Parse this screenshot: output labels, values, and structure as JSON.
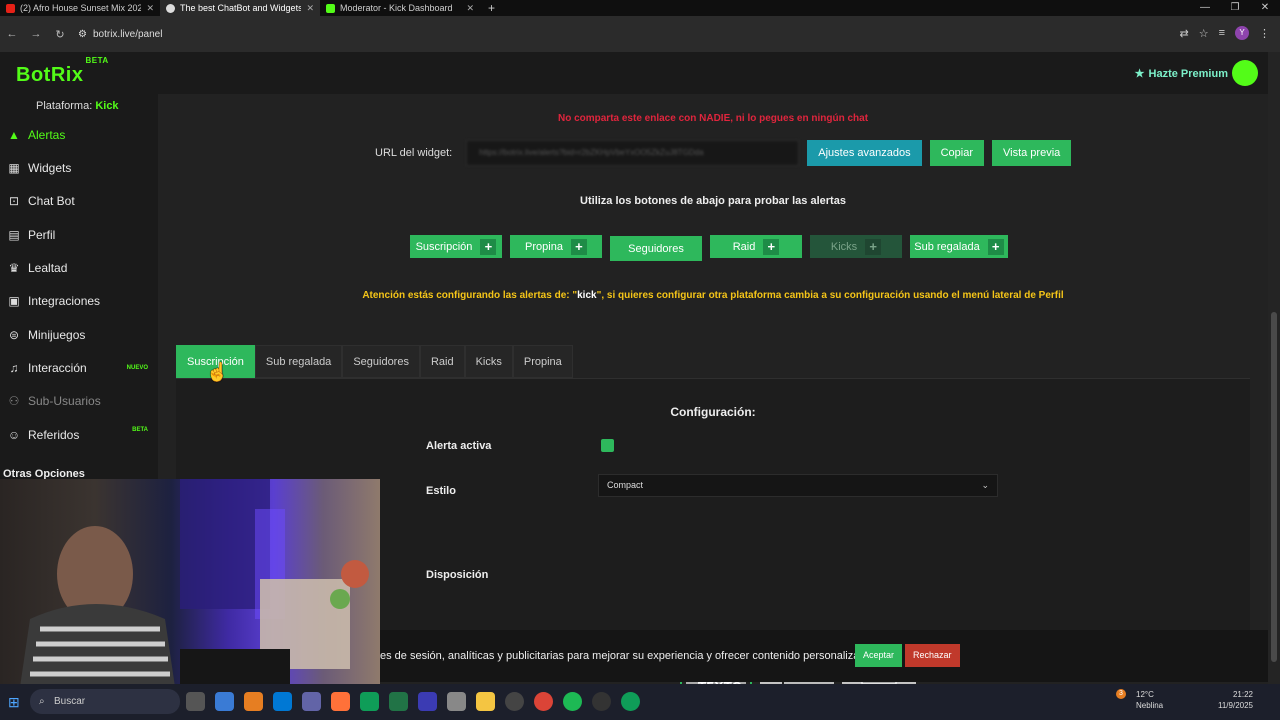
{
  "browser": {
    "tabs": [
      {
        "title": "(2) Afro House Sunset Mix 2025",
        "color": "#e62117",
        "active": false
      },
      {
        "title": "The best ChatBot and Widgets",
        "color": "#dddddd",
        "active": true
      },
      {
        "title": "Moderator - Kick Dashboard",
        "color": "#53fc18",
        "active": false
      }
    ],
    "url": "botrix.live/panel"
  },
  "app": {
    "logo": "BotRix",
    "logo_badge": "BETA",
    "premium": "Hazte Premium",
    "platform_label": "Plataforma:",
    "platform_value": "Kick"
  },
  "sidebar": {
    "items": [
      {
        "label": "Alertas",
        "icon": "triangle-icon"
      },
      {
        "label": "Widgets",
        "icon": "grid-icon"
      },
      {
        "label": "Chat Bot",
        "icon": "robot-icon"
      },
      {
        "label": "Perfil",
        "icon": "id-card-icon"
      },
      {
        "label": "Lealtad",
        "icon": "trophy-icon"
      },
      {
        "label": "Integraciones",
        "icon": "puzzle-icon"
      },
      {
        "label": "Minijuegos",
        "icon": "gamepad-icon"
      },
      {
        "label": "Interacción",
        "icon": "music-icon",
        "badge": "NUEVO"
      },
      {
        "label": "Sub-Usuarios",
        "icon": "sub-users-icon"
      },
      {
        "label": "Referidos",
        "icon": "users-icon",
        "badge": "BETA"
      }
    ],
    "section": "Otras Opciones"
  },
  "main": {
    "warning_red": "No comparta este enlace con NADIE, ni lo pegues en ningún chat",
    "widget_label": "URL del widget:",
    "widget_url": "https://botrix.live/alerts?bid=r2bZKHpVbeYxOO5ZkZuJ8TGDda",
    "btn_advanced": "Ajustes avanzados",
    "btn_copy": "Copiar",
    "btn_preview": "Vista previa",
    "test_title": "Utiliza los botones de abajo para probar las alertas",
    "test_buttons": [
      "Suscripción",
      "Propina",
      "Seguidores",
      "Raid",
      "Kicks",
      "Sub regalada"
    ],
    "warning_yellow_pre": "Atención estás configurando las alertas de: \"",
    "warning_yellow_platform": "kick",
    "warning_yellow_post": "\", si quieres configurar otra plataforma cambia a su configuración usando el menú lateral de Perfil",
    "tabs": [
      "Suscripción",
      "Sub regalada",
      "Seguidores",
      "Raid",
      "Kicks",
      "Propina"
    ],
    "config": {
      "title": "Configuración:",
      "active_label": "Alerta activa",
      "style_label": "Estilo",
      "style_value": "Compact",
      "layout_label": "Disposición",
      "layout_text": "TEXTO"
    }
  },
  "cookie": {
    "text": "es de sesión, analíticas y publicitarias para mejorar su experiencia y ofrecer contenido personalizado.",
    "accept": "Aceptar",
    "reject": "Rechazar"
  },
  "taskbar": {
    "search": "Buscar",
    "weather_temp": "12°C",
    "weather_desc": "Neblina",
    "weather_badge": "3",
    "time": "21:22",
    "date": "11/9/2025"
  },
  "colors": {
    "brand_green": "#53fc18",
    "button_green": "#2eb85c",
    "button_teal": "#1b9aaa",
    "warning_red": "#e0253d",
    "warning_yellow": "#f5c518",
    "reject_red": "#c0392b"
  }
}
